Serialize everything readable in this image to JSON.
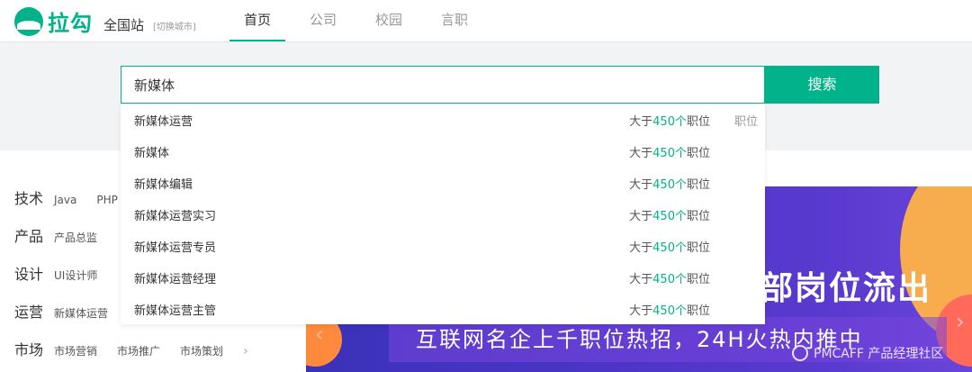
{
  "header": {
    "logo_text": "拉勾",
    "site_name": "全国站",
    "switch_city": "[切换城市]",
    "nav": [
      {
        "label": "首页",
        "active": true
      },
      {
        "label": "公司",
        "active": false
      },
      {
        "label": "校园",
        "active": false
      },
      {
        "label": "言职",
        "active": false
      }
    ]
  },
  "search": {
    "value": "新媒体",
    "button_label": "搜索"
  },
  "suggestions": [
    {
      "keyword": "新媒体运营",
      "prefix": "大于",
      "count": "450个",
      "suffix": "职位",
      "type": "职位"
    },
    {
      "keyword": "新媒体",
      "prefix": "大于",
      "count": "450个",
      "suffix": "职位",
      "type": ""
    },
    {
      "keyword": "新媒体编辑",
      "prefix": "大于",
      "count": "450个",
      "suffix": "职位",
      "type": ""
    },
    {
      "keyword": "新媒体运营实习",
      "prefix": "大于",
      "count": "450个",
      "suffix": "职位",
      "type": ""
    },
    {
      "keyword": "新媒体运营专员",
      "prefix": "大于",
      "count": "450个",
      "suffix": "职位",
      "type": ""
    },
    {
      "keyword": "新媒体运营经理",
      "prefix": "大于",
      "count": "450个",
      "suffix": "职位",
      "type": ""
    },
    {
      "keyword": "新媒体运营主管",
      "prefix": "大于",
      "count": "450个",
      "suffix": "职位",
      "type": ""
    }
  ],
  "categories": [
    {
      "title": "技术",
      "tags": [
        "Java",
        "PHP"
      ]
    },
    {
      "title": "产品",
      "tags": [
        "产品总监"
      ]
    },
    {
      "title": "设计",
      "tags": [
        "UI设计师"
      ]
    },
    {
      "title": "运营",
      "tags": [
        "新媒体运营"
      ]
    },
    {
      "title": "市场",
      "tags": [
        "市场营销",
        "市场推广",
        "市场策划"
      ]
    }
  ],
  "banner": {
    "headline": "部岗位流出",
    "subline": "互联网名企上千职位热招，24H火热内推中"
  },
  "watermark": "PMCAFF 产品经理社区",
  "icons": {
    "logo": "lagou-logo-icon",
    "arrow": "chevron-right-icon",
    "watermark": "pmcaff-logo-icon"
  },
  "colors": {
    "brand": "#00b38a",
    "banner": "#4b35c6"
  }
}
